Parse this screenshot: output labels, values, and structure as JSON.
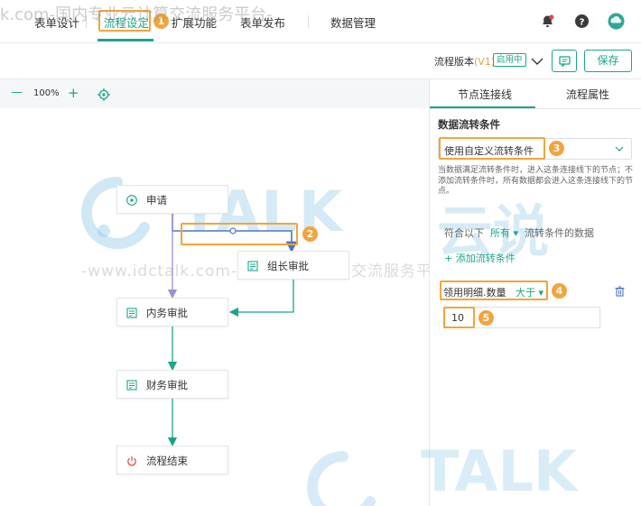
{
  "nav": {
    "tabs": [
      {
        "label": "表单设计"
      },
      {
        "label": "流程设定"
      },
      {
        "label": "扩展功能"
      },
      {
        "label": "表单发布"
      },
      {
        "label": "数据管理"
      }
    ],
    "help_label": "?"
  },
  "markers": [
    "1",
    "2",
    "3",
    "4",
    "5"
  ],
  "toolbar": {
    "version_prefix": "流程版本",
    "version_value": "(V1)",
    "version_status": "启用中",
    "save_label": "保存"
  },
  "canvas": {
    "zoom_minus": "—",
    "zoom_level": "100%",
    "zoom_plus": "+",
    "nodes": [
      {
        "label": "申请"
      },
      {
        "label": "组长审批"
      },
      {
        "label": "内务审批"
      },
      {
        "label": "财务审批"
      },
      {
        "label": "流程结束"
      }
    ]
  },
  "panel": {
    "tabs": [
      {
        "label": "节点连接线"
      },
      {
        "label": "流程属性"
      }
    ],
    "section_title": "数据流转条件",
    "condition_mode": "使用自定义流转条件",
    "description": "当数据满足流转条件时，进入这条连接线下的节点；不添加流转条件时，所有数据都会进入这条连接线下的节点。",
    "match_prefix": "符合以下",
    "match_mode": "所有",
    "match_suffix": "流转条件的数据",
    "add_condition": "+ 添加流转条件",
    "condition": {
      "field": "领用明细.数量",
      "operator": "大于",
      "value": "10"
    }
  },
  "watermarks": {
    "top": "k.com-国内专业云计算交流服务平台-",
    "middle": "-www.idctalk.com-国内专业云计算交流服务平台-",
    "logo": "TALK",
    "logo_cn": "云说",
    "logo_bottom": "TALK"
  },
  "colors": {
    "accent": "#1aa589",
    "highlight": "#f3a43b",
    "connector": "#4a78c8",
    "connector_alt": "#9b8fd6"
  }
}
